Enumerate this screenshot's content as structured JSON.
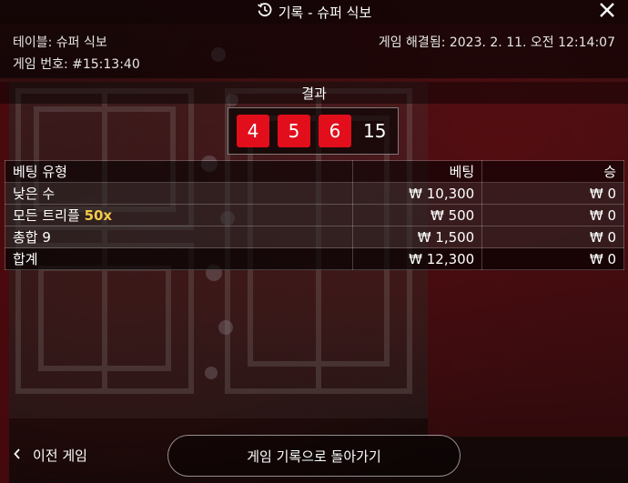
{
  "header": {
    "title": "기록 - 슈퍼 식보",
    "history_icon": "history-icon",
    "close_icon": "close-icon"
  },
  "info": {
    "table_label": "테이블: 슈퍼 식보",
    "game_number_label": "게임 번호: #15:13:40",
    "resolved_label": "게임 해결됨: 2023. 2. 11. 오전 12:14:07"
  },
  "result": {
    "heading": "결과",
    "dice": [
      "4",
      "5",
      "6"
    ],
    "total": "15",
    "die_color": "#e20e1b"
  },
  "bets_table": {
    "headers": {
      "type": "베팅 유형",
      "bet": "베팅",
      "win": "승"
    },
    "rows": [
      {
        "type": "낮은 수",
        "multiplier": "",
        "bet": "₩ 10,300",
        "win": "₩ 0"
      },
      {
        "type": "모든 트리플",
        "multiplier": "50x",
        "bet": "₩ 500",
        "win": "₩ 0"
      },
      {
        "type": "총합 9",
        "multiplier": "",
        "bet": "₩ 1,500",
        "win": "₩ 0"
      }
    ],
    "total": {
      "type": "합계",
      "bet": "₩ 12,300",
      "win": "₩ 0"
    },
    "multiplier_color": "#f2c94c"
  },
  "footer": {
    "prev_game": "이전 게임",
    "back_to_history": "게임 기록으로 돌아가기",
    "chevron_icon": "chevron-left-icon"
  }
}
